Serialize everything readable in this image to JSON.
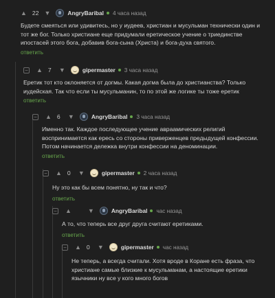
{
  "comments": [
    {
      "rating": "22",
      "user": "AngryBaribal",
      "time": "4 часа назад",
      "text": "Будете смеяться или удивитесь, но у иудеев, христиан и мусульман технически один и тот же бог. Только христиане еще придумали еретическое учение о триединстве ипостасей этого бога, добавив бога-сына (Христа) и бога-духа святого.",
      "reply": "ответить"
    },
    {
      "rating": "7",
      "user": "gipermaster",
      "time": "3 часа назад",
      "text": "Еретик тот кто оклоняется от догмы. Какая догма была до христианства? Только иудейская. Так что если ты мусульманин, то по этой же логике ты тоже еретик",
      "reply": "ответить"
    },
    {
      "rating": "6",
      "user": "AngryBaribal",
      "time": "3 часа назад",
      "text": "Именно так. Каждое последующее учение авраамических религий воспринимается как ересь со стороны приверженцев предыдущей конфессии. Потом начинается дележка внутри конфессии на деноминации.",
      "reply": "ответить"
    },
    {
      "rating": "0",
      "user": "gipermaster",
      "time": "2 часа назад",
      "text": "Ну это как бы всем понятно, ну так и что?",
      "reply": "ответить"
    },
    {
      "rating": "",
      "user": "AngryBaribal",
      "time": "час назад",
      "text": "А то, что теперь все друг друга считают еретиками.",
      "reply": "ответить"
    },
    {
      "rating": "0",
      "user": "gipermaster",
      "time": "час назад",
      "text": "Не теперь, а всегда считали. Хотя вроде в Коране есть фраза, что христиане самые близкие к мусульманам, а настоящие еретики язычники ну все у кого много богов",
      "reply": ""
    }
  ],
  "icons": {
    "collapse": "minus-icon",
    "vote_up": "arrow-up-icon",
    "vote_down": "arrow-down-icon",
    "online": "online-dot"
  },
  "colors": {
    "background": "#1f1f1f",
    "accent": "#67a64c",
    "text": "#d8d8d8",
    "muted": "#9a9a9a"
  }
}
